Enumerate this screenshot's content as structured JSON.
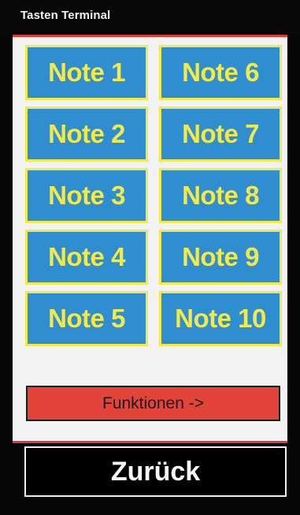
{
  "header": {
    "title": "Tasten Terminal"
  },
  "notes": [
    {
      "label": "Note 1"
    },
    {
      "label": "Note 6"
    },
    {
      "label": "Note 2"
    },
    {
      "label": "Note 7"
    },
    {
      "label": "Note 3"
    },
    {
      "label": "Note 8"
    },
    {
      "label": "Note 4"
    },
    {
      "label": "Note 9"
    },
    {
      "label": "Note 5"
    },
    {
      "label": "Note 10"
    }
  ],
  "functions_button": {
    "label": "Funktionen ->"
  },
  "back_button": {
    "label": "Zurück"
  },
  "colors": {
    "note_background": "#2f8ecf",
    "note_text": "#f3e94a",
    "panel_border": "#e03a30",
    "functions_background": "#e3443a",
    "screen_background": "#060606"
  }
}
